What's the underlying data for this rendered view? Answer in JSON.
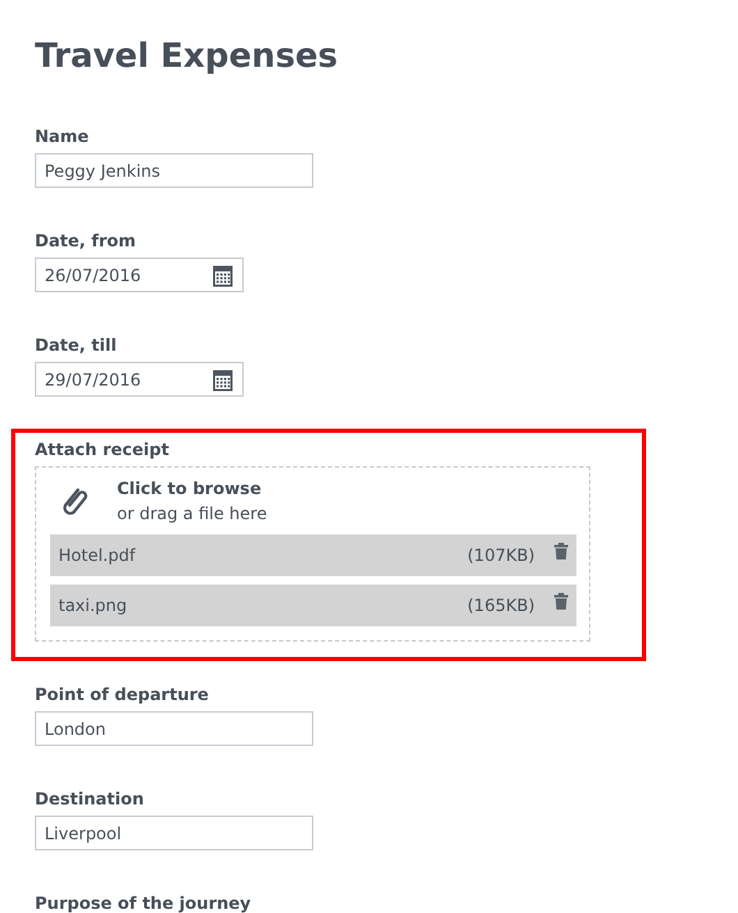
{
  "title": "Travel Expenses",
  "fields": [
    {
      "kind": "text",
      "label": "Name",
      "value": "Peggy Jenkins",
      "highlighted": false
    },
    {
      "kind": "date",
      "label": "Date, from",
      "value": "26/07/2016",
      "highlighted": false
    },
    {
      "kind": "date",
      "label": "Date, till",
      "value": "29/07/2016",
      "highlighted": false
    },
    {
      "kind": "upload",
      "label": "Attach receipt",
      "prompt": "Click to browse",
      "hint": "or drag a file here",
      "highlighted": true,
      "files": [
        {
          "name": "Hotel.pdf",
          "size": "(107KB)"
        },
        {
          "name": "taxi.png",
          "size": "(165KB)"
        }
      ]
    },
    {
      "kind": "text",
      "label": "Point of departure",
      "value": "London",
      "highlighted": false
    },
    {
      "kind": "text",
      "label": "Destination",
      "value": "Liverpool",
      "highlighted": false
    },
    {
      "kind": "label",
      "label": "Purpose of the journey",
      "highlighted": false
    }
  ]
}
